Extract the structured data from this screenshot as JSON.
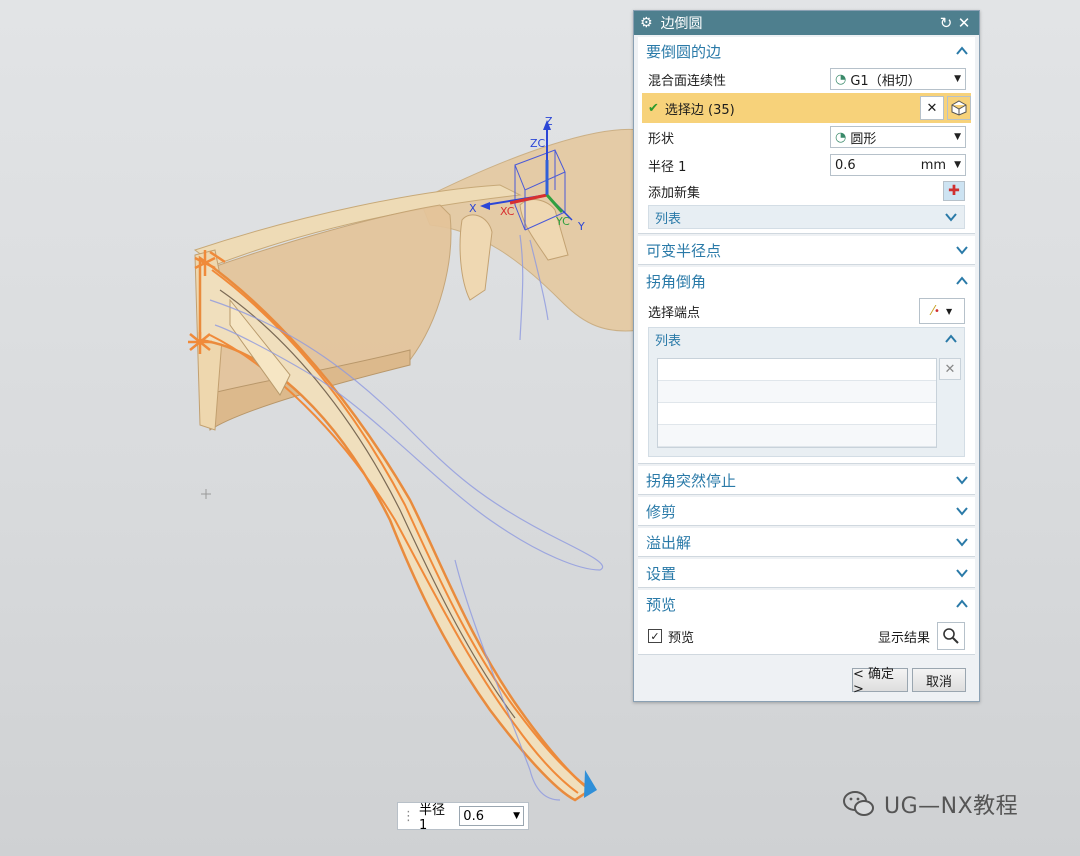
{
  "dialog": {
    "title": "边倒圆",
    "sections": {
      "edges": {
        "label": "要倒圆的边"
      },
      "variable_radius": {
        "label": "可变半径点"
      },
      "corner_setback": {
        "label": "拐角倒角"
      },
      "corner_stop": {
        "label": "拐角突然停止"
      },
      "trim": {
        "label": "修剪"
      },
      "overflow": {
        "label": "溢出解"
      },
      "settings": {
        "label": "设置"
      },
      "preview": {
        "label": "预览"
      }
    },
    "continuity": {
      "label": "混合面连续性",
      "value": "G1（相切）"
    },
    "select_edge": {
      "label": "选择边 (35)"
    },
    "shape": {
      "label": "形状",
      "value": "圆形"
    },
    "radius": {
      "label": "半径 1",
      "value": "0.6",
      "unit": "mm"
    },
    "add_new_set": {
      "label": "添加新集"
    },
    "list": {
      "label": "列表"
    },
    "corner": {
      "select_end_label": "选择端点",
      "list_label": "列表"
    },
    "preview": {
      "checkbox_label": "预览",
      "checked": true,
      "show_result_label": "显示结果"
    },
    "buttons": {
      "ok": "< 确定 >",
      "cancel": "取消"
    }
  },
  "viewport": {
    "axis_labels": {
      "z": "Z",
      "zc": "ZC",
      "x": "X",
      "xc": "XC",
      "yc": "YC",
      "y": "Y"
    },
    "radius_handle": {
      "label": "半径 1",
      "value": "0.6"
    }
  },
  "watermark": {
    "text": "UG—NX教程"
  },
  "colors": {
    "title_bar": "#4e7f8e",
    "section_header_text": "#2a7aa8",
    "selected_row": "#f7d27a",
    "model_fill": "#e8c898",
    "edge_highlight": "#f08a3a"
  }
}
